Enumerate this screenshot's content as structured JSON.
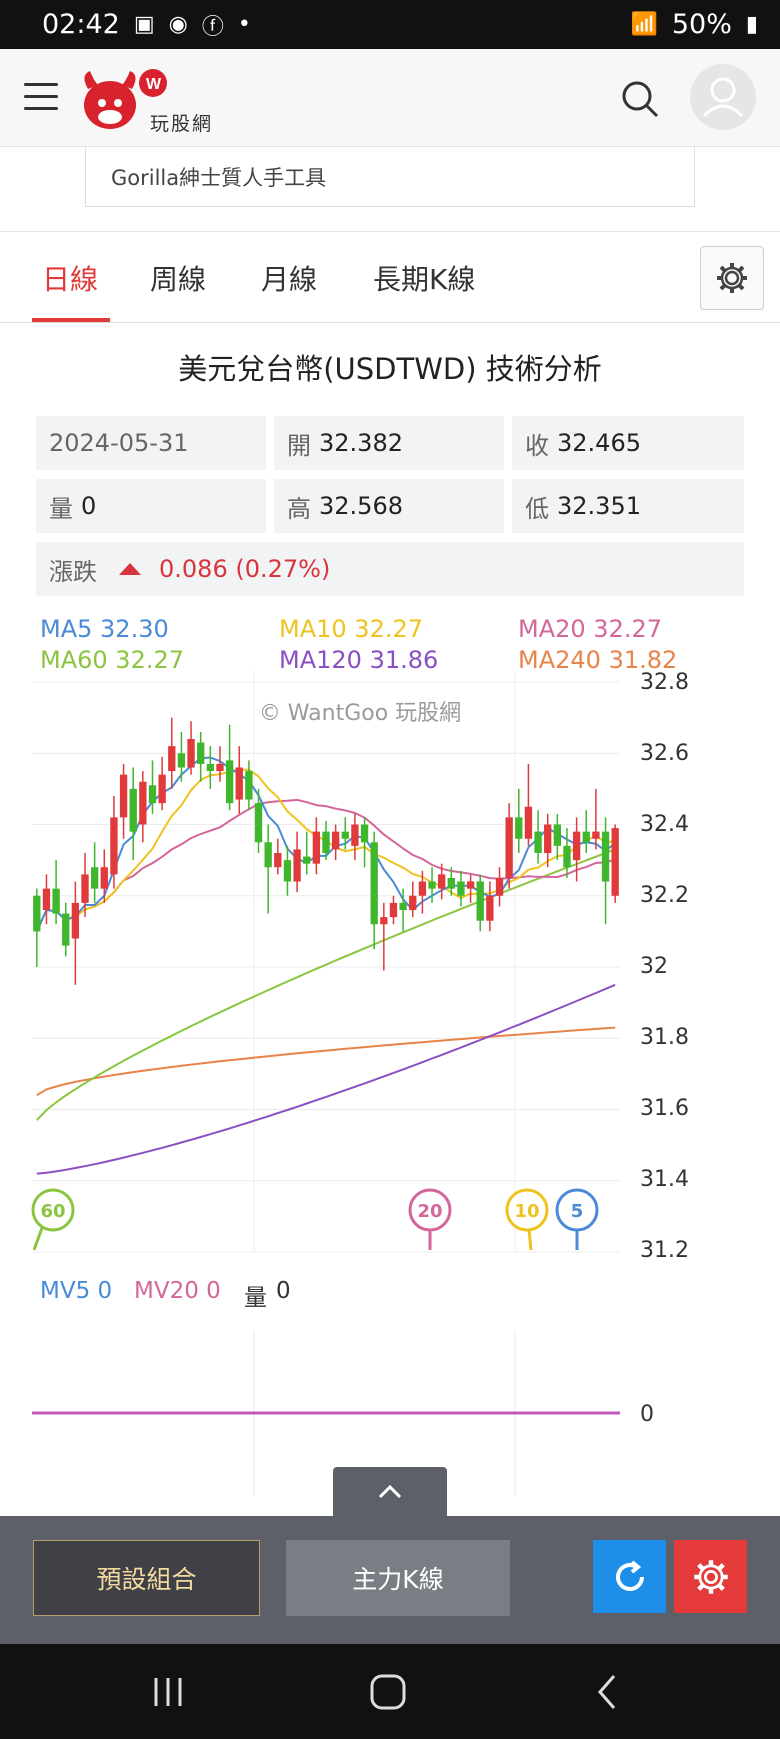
{
  "status_bar": {
    "time": "02:42",
    "battery": "50%"
  },
  "app": {
    "logo_text": "玩股網",
    "ad_text": "Gorilla紳士質人手工具"
  },
  "tabs": [
    {
      "label": "日線",
      "active": true
    },
    {
      "label": "周線",
      "active": false
    },
    {
      "label": "月線",
      "active": false
    },
    {
      "label": "長期K線",
      "active": false
    }
  ],
  "title": "美元兌台幣(USDTWD) 技術分析",
  "quote": {
    "date": "2024-05-31",
    "open_label": "開",
    "open": "32.382",
    "close_label": "收",
    "close": "32.465",
    "volume_label": "量",
    "volume": "0",
    "high_label": "高",
    "high": "32.568",
    "low_label": "低",
    "low": "32.351",
    "change_label": "漲跌",
    "change": "0.086 (0.27%)"
  },
  "ma_legend": {
    "ma5": "MA5 32.30",
    "ma10": "MA10 32.27",
    "ma20": "MA20 32.27",
    "ma60": "MA60 32.27",
    "ma120": "MA120 31.86",
    "ma240": "MA240 31.82"
  },
  "watermark": "© WantGoo 玩股網",
  "markers": {
    "m60": "60",
    "m20": "20",
    "m10": "10",
    "m5": "5"
  },
  "volume_legend": {
    "mv5": "MV5 0",
    "mv20": "MV20 0",
    "vol_label": "量",
    "vol": "0"
  },
  "buttons": {
    "preset": "預設組合",
    "main_k": "主力K線"
  },
  "colors": {
    "up": "#e03a3a",
    "down": "#3fb62b",
    "ma5": "#4a8ad6",
    "ma10": "#eec31f",
    "ma20": "#d3669a",
    "ma60": "#8bc53f",
    "ma120": "#8b4fc4",
    "ma240": "#e8844a"
  },
  "chart_data": {
    "type": "candlestick",
    "y_ticks": [
      "32.8",
      "32.6",
      "32.4",
      "32.2",
      "32",
      "31.8",
      "31.6",
      "31.4",
      "31.2"
    ],
    "ylim": [
      31.2,
      32.8
    ],
    "candles": [
      [
        32.2,
        32.1,
        32.22,
        32.0
      ],
      [
        32.16,
        32.22,
        32.26,
        32.12
      ],
      [
        32.22,
        32.15,
        32.3,
        32.12
      ],
      [
        32.15,
        32.06,
        32.18,
        32.03
      ],
      [
        32.08,
        32.18,
        32.24,
        31.95
      ],
      [
        32.18,
        32.26,
        32.32,
        32.14
      ],
      [
        32.28,
        32.22,
        32.35,
        32.18
      ],
      [
        32.22,
        32.28,
        32.33,
        32.18
      ],
      [
        32.26,
        32.42,
        32.48,
        32.22
      ],
      [
        32.42,
        32.54,
        32.57,
        32.36
      ],
      [
        32.5,
        32.38,
        32.56,
        32.3
      ],
      [
        32.4,
        32.52,
        32.55,
        32.35
      ],
      [
        32.51,
        32.46,
        32.58,
        32.43
      ],
      [
        32.46,
        32.54,
        32.59,
        32.44
      ],
      [
        32.55,
        32.62,
        32.7,
        32.5
      ],
      [
        32.6,
        32.56,
        32.66,
        32.52
      ],
      [
        32.56,
        32.64,
        32.69,
        32.54
      ],
      [
        32.63,
        32.57,
        32.66,
        32.52
      ],
      [
        32.57,
        32.55,
        32.62,
        32.5
      ],
      [
        32.55,
        32.57,
        32.62,
        32.52
      ],
      [
        32.58,
        32.46,
        32.68,
        32.44
      ],
      [
        32.47,
        32.56,
        32.62,
        32.43
      ],
      [
        32.55,
        32.47,
        32.58,
        32.44
      ],
      [
        32.46,
        32.35,
        32.5,
        32.32
      ],
      [
        32.35,
        32.28,
        32.4,
        32.15
      ],
      [
        32.28,
        32.32,
        32.36,
        32.26
      ],
      [
        32.3,
        32.24,
        32.34,
        32.2
      ],
      [
        32.24,
        32.33,
        32.38,
        32.21
      ],
      [
        32.31,
        32.29,
        32.38,
        32.26
      ],
      [
        32.29,
        32.38,
        32.42,
        32.26
      ],
      [
        32.38,
        32.32,
        32.41,
        32.3
      ],
      [
        32.33,
        32.38,
        32.4,
        32.3
      ],
      [
        32.38,
        32.36,
        32.42,
        32.33
      ],
      [
        32.34,
        32.4,
        32.43,
        32.3
      ],
      [
        32.4,
        32.35,
        32.42,
        32.28
      ],
      [
        32.35,
        32.12,
        32.38,
        32.05
      ],
      [
        32.12,
        32.14,
        32.18,
        31.99
      ],
      [
        32.14,
        32.18,
        32.2,
        32.12
      ],
      [
        32.18,
        32.16,
        32.22,
        32.1
      ],
      [
        32.16,
        32.2,
        32.24,
        32.14
      ],
      [
        32.2,
        32.24,
        32.27,
        32.15
      ],
      [
        32.24,
        32.22,
        32.28,
        32.18
      ],
      [
        32.22,
        32.26,
        32.29,
        32.19
      ],
      [
        32.25,
        32.22,
        32.28,
        32.2
      ],
      [
        32.24,
        32.2,
        32.27,
        32.17
      ],
      [
        32.22,
        32.24,
        32.26,
        32.18
      ],
      [
        32.24,
        32.13,
        32.26,
        32.1
      ],
      [
        32.13,
        32.2,
        32.24,
        32.1
      ],
      [
        32.2,
        32.25,
        32.28,
        32.17
      ],
      [
        32.25,
        32.42,
        32.46,
        32.22
      ],
      [
        32.42,
        32.36,
        32.5,
        32.32
      ],
      [
        32.36,
        32.45,
        32.57,
        32.34
      ],
      [
        32.38,
        32.32,
        32.44,
        32.29
      ],
      [
        32.32,
        32.4,
        32.43,
        32.28
      ],
      [
        32.4,
        32.34,
        32.43,
        32.3
      ],
      [
        32.34,
        32.28,
        32.39,
        32.25
      ],
      [
        32.3,
        32.38,
        32.42,
        32.24
      ],
      [
        32.38,
        32.35,
        32.44,
        32.32
      ],
      [
        32.36,
        32.38,
        32.5,
        32.33
      ],
      [
        32.38,
        32.24,
        32.42,
        32.12
      ],
      [
        32.2,
        32.39,
        32.4,
        32.18
      ]
    ]
  }
}
